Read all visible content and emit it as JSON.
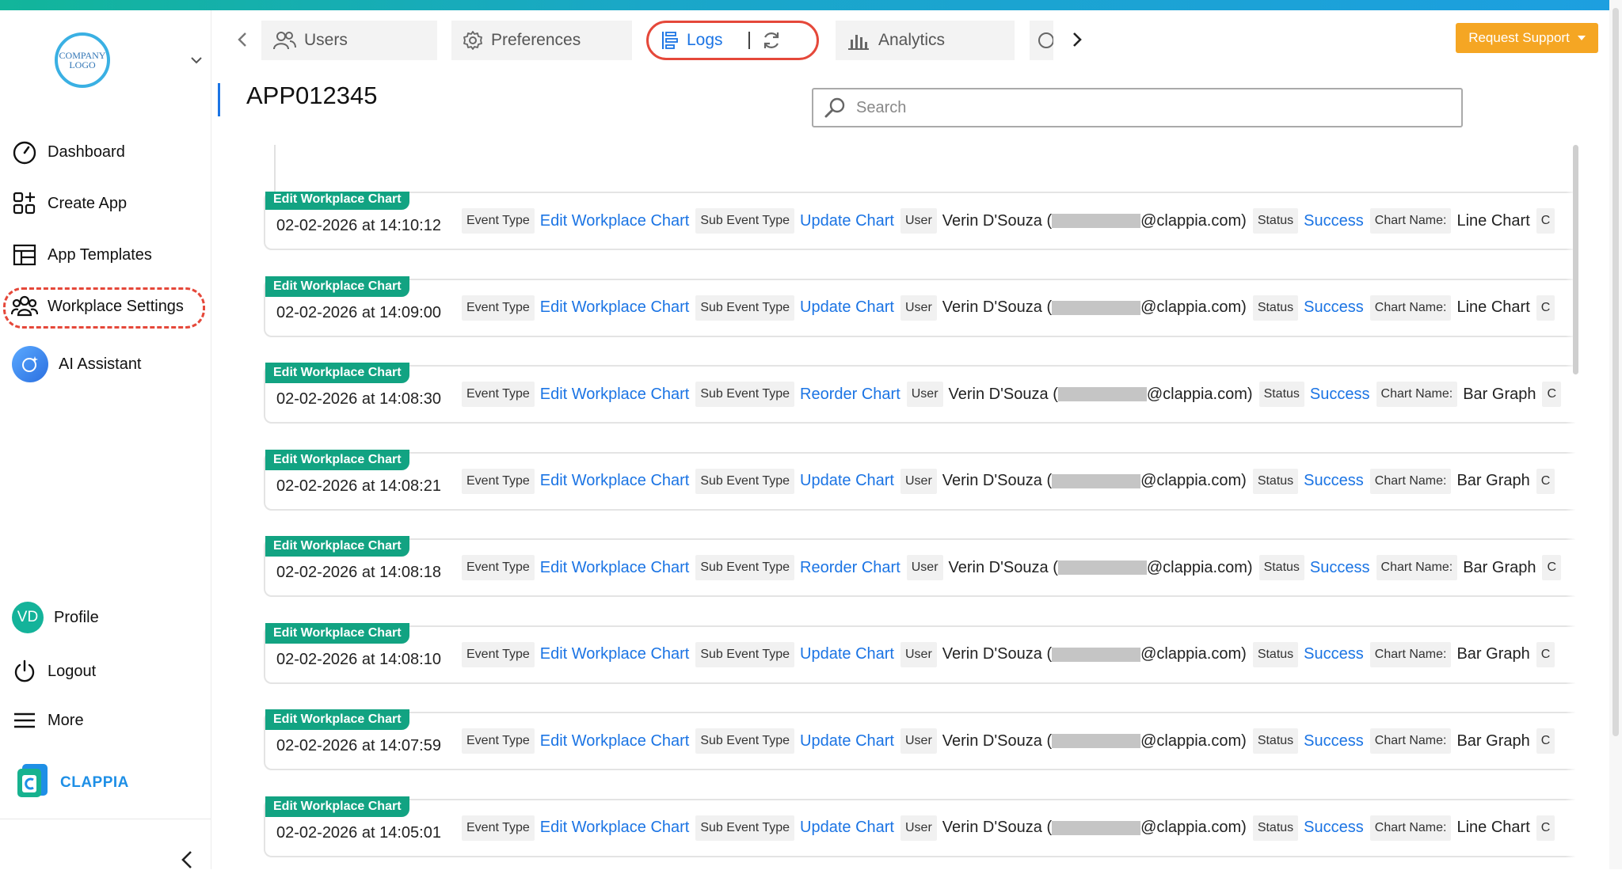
{
  "sidebar": {
    "logo_text_line1": "COMPANY",
    "logo_text_line2": "LOGO",
    "items": [
      {
        "label": "Dashboard",
        "icon": "gauge-icon"
      },
      {
        "label": "Create App",
        "icon": "grid-plus-icon"
      },
      {
        "label": "App Templates",
        "icon": "templates-icon"
      },
      {
        "label": "Workplace Settings",
        "icon": "people-icon"
      },
      {
        "label": "AI Assistant",
        "icon": "ai-sparkle-icon"
      }
    ],
    "bottom": [
      {
        "label": "Profile",
        "avatar": "VD"
      },
      {
        "label": "Logout",
        "icon": "power-icon"
      },
      {
        "label": "More",
        "icon": "hamburger-icon"
      }
    ],
    "brand": "CLAPPIA"
  },
  "tabs": [
    {
      "label": "Users",
      "icon": "users-icon"
    },
    {
      "label": "Preferences",
      "icon": "gear-icon"
    },
    {
      "label": "Logs",
      "icon": "logs-icon",
      "active": true
    },
    {
      "label": "Analytics",
      "icon": "bar-chart-icon"
    }
  ],
  "request_support": "Request Support",
  "page_title": "APP012345",
  "search_placeholder": "Search",
  "labels": {
    "event_type": "Event Type",
    "sub_event_type": "Sub Event Type",
    "user": "User",
    "status": "Status",
    "chart_name": "Chart Name:"
  },
  "logs": [
    {
      "badge": "Edit Workplace Chart",
      "time": "02-02-2026 at 14:10:12",
      "event": "Edit Workplace Chart",
      "sub_event": "Update Chart",
      "user_name": "Verin D'Souza (",
      "user_domain": "@clappia.com)",
      "status": "Success",
      "chart_name": "Line Chart",
      "more": "C"
    },
    {
      "badge": "Edit Workplace Chart",
      "time": "02-02-2026 at 14:09:00",
      "event": "Edit Workplace Chart",
      "sub_event": "Update Chart",
      "user_name": "Verin D'Souza (",
      "user_domain": "@clappia.com)",
      "status": "Success",
      "chart_name": "Line Chart",
      "more": "C"
    },
    {
      "badge": "Edit Workplace Chart",
      "time": "02-02-2026 at 14:08:30",
      "event": "Edit Workplace Chart",
      "sub_event": "Reorder Chart",
      "user_name": "Verin D'Souza (",
      "user_domain": "@clappia.com)",
      "status": "Success",
      "chart_name": "Bar Graph",
      "more": "C"
    },
    {
      "badge": "Edit Workplace Chart",
      "time": "02-02-2026 at 14:08:21",
      "event": "Edit Workplace Chart",
      "sub_event": "Update Chart",
      "user_name": "Verin D'Souza (",
      "user_domain": "@clappia.com)",
      "status": "Success",
      "chart_name": "Bar Graph",
      "more": "C"
    },
    {
      "badge": "Edit Workplace Chart",
      "time": "02-02-2026 at 14:08:18",
      "event": "Edit Workplace Chart",
      "sub_event": "Reorder Chart",
      "user_name": "Verin D'Souza (",
      "user_domain": "@clappia.com)",
      "status": "Success",
      "chart_name": "Bar Graph",
      "more": "C"
    },
    {
      "badge": "Edit Workplace Chart",
      "time": "02-02-2026 at 14:08:10",
      "event": "Edit Workplace Chart",
      "sub_event": "Update Chart",
      "user_name": "Verin D'Souza (",
      "user_domain": "@clappia.com)",
      "status": "Success",
      "chart_name": "Bar Graph",
      "more": "C"
    },
    {
      "badge": "Edit Workplace Chart",
      "time": "02-02-2026 at 14:07:59",
      "event": "Edit Workplace Chart",
      "sub_event": "Update Chart",
      "user_name": "Verin D'Souza (",
      "user_domain": "@clappia.com)",
      "status": "Success",
      "chart_name": "Bar Graph",
      "more": "C"
    },
    {
      "badge": "Edit Workplace Chart",
      "time": "02-02-2026 at 14:05:01",
      "event": "Edit Workplace Chart",
      "sub_event": "Update Chart",
      "user_name": "Verin D'Souza (",
      "user_domain": "@clappia.com)",
      "status": "Success",
      "chart_name": "Line Chart",
      "more": "C"
    }
  ],
  "colors": {
    "accent_blue": "#1b74e4",
    "badge_green": "#12a382",
    "highlight_red": "#e5483a",
    "support_orange": "#f5a623"
  }
}
